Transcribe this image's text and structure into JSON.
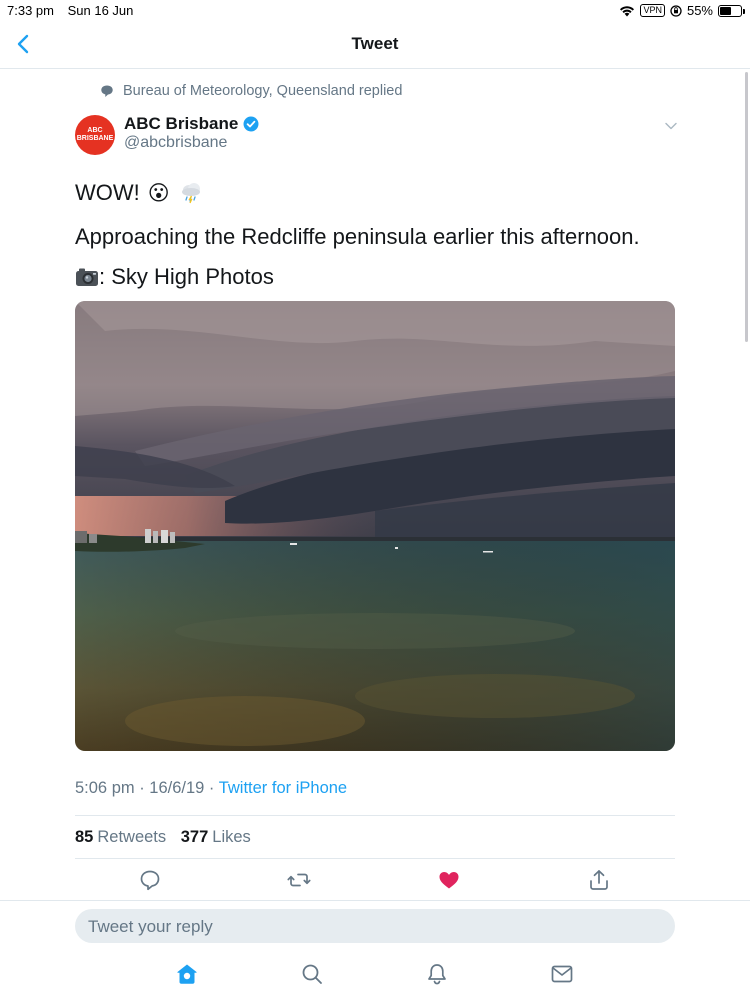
{
  "status_bar": {
    "time": "7:33 pm",
    "date": "Sun 16 Jun",
    "vpn": "VPN",
    "battery": "55%",
    "battery_level": 0.55
  },
  "nav": {
    "title": "Tweet",
    "back_icon": "chevron-left-icon"
  },
  "tweet": {
    "replied_context": "Bureau of Meteorology, Queensland replied",
    "author": {
      "name": "ABC Brisbane",
      "handle": "@abcbrisbane",
      "verified": true,
      "avatar_text_top": "ABC",
      "avatar_text": "BRISBANE"
    },
    "lines": {
      "line1": "WOW!",
      "line1_emoji": "😮",
      "line2": "Approaching the Redcliffe peninsula earlier this afternoon.",
      "line3": ": Sky High Photos"
    },
    "photo_alt": "Storm shelf cloud over Redcliffe",
    "time": "5:06 pm · 16/6/19 · ",
    "source": "Twitter for iPhone",
    "retweets_count": "85",
    "retweets_label": "Retweets",
    "likes_count": "377",
    "likes_label": "Likes"
  },
  "actions": [
    "reply-icon",
    "retweet-icon",
    "like-icon",
    "share-icon"
  ],
  "reply_placeholder": "Tweet your reply",
  "tabs": [
    "home-icon",
    "search-icon",
    "notifications-icon",
    "messages-icon"
  ],
  "colors": {
    "accent": "#1da1f2",
    "like": "#e0245e",
    "avatar": "#e53222",
    "muted": "#657786"
  }
}
